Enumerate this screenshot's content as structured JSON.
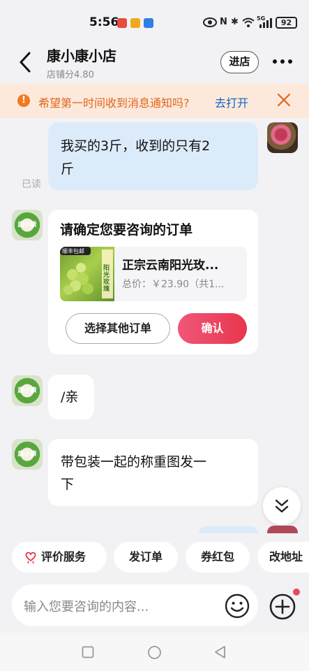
{
  "status": {
    "time": "5:56",
    "battery": "92",
    "network": "5G"
  },
  "header": {
    "shop_name": "康小康小店",
    "rating": "店铺分4.80",
    "enter_label": "进店"
  },
  "notice": {
    "text": "希望第一时间收到消息通知吗?",
    "link": "去打开"
  },
  "messages": [
    {
      "from": "me",
      "text_line1": "我买的3斤，收到的只有2",
      "text_line2": "斤",
      "status": "已读"
    },
    {
      "from": "shop",
      "type": "order_confirm",
      "title": "请确定您要咨询的订单",
      "product": {
        "name": "正宗云南阳光玫...",
        "price": "总价：￥23.90（共1...",
        "img_badge": "顺丰包邮",
        "img_tag": "阳光玫瑰"
      },
      "other_label": "选择其他订单",
      "confirm_label": "确认"
    },
    {
      "from": "shop",
      "text": "/亲"
    },
    {
      "from": "shop",
      "text_line1": "带包装一起的称重图发一",
      "text_line2": "下"
    }
  ],
  "shop_avatar_text": "康小康",
  "quick_actions": [
    "评价服务",
    "发订单",
    "券红包",
    "改地址"
  ],
  "input": {
    "placeholder": "输入您要咨询的内容..."
  },
  "colors": {
    "accent": "#e8364c",
    "notice_bg": "#fde9dc",
    "notice_text": "#e0661c",
    "link": "#1565c0",
    "bubble_me": "#dcebfa"
  }
}
